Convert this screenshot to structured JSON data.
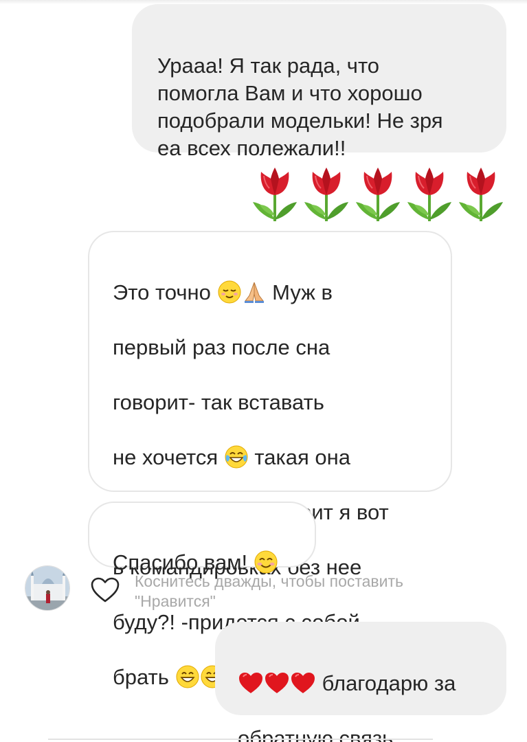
{
  "conversation": {
    "messages": [
      {
        "sender": "me",
        "text": "Урааа! Я так рада, что\nпомогла Вам и что хорошо\nподобрали модельки!  Не зря\nеа всех полежали!!"
      },
      {
        "sender": "me",
        "emoji": "tulip",
        "count": 5
      },
      {
        "sender": "them",
        "lines": [
          "Это точно ",
          " Муж  в",
          "первый раз после сна",
          "говорит- так вставать",
          "не хочется ",
          " такая она",
          "классная , как говорит я вот",
          "в командировках без нее",
          "буду?! -придется с собой",
          "брать "
        ]
      },
      {
        "sender": "them",
        "text": "Спасибо вам! "
      },
      {
        "sender": "me",
        "line1": " благодарю за",
        "line2": "обратную связь"
      }
    ],
    "like_hint": "Коснитесь дважды, чтобы поставить\n\"Нравится\""
  },
  "icons": {
    "msg3": [
      "relieved-face-emoji",
      "folded-hands-emoji",
      "tears-of-joy-emoji",
      "grinning-face-emoji",
      "grinning-face-emoji"
    ],
    "msg4": "smiling-face-emoji",
    "msg5": [
      "red-heart-emoji",
      "red-heart-emoji",
      "red-heart-emoji"
    ],
    "like": "heart-outline-icon"
  },
  "colors": {
    "outgoing_bubble": "#efefef",
    "incoming_border": "#e6e6e6",
    "hint_text": "#a8a8a8",
    "tulip_red": "#d81e2c",
    "tulip_green": "#5aa832"
  }
}
